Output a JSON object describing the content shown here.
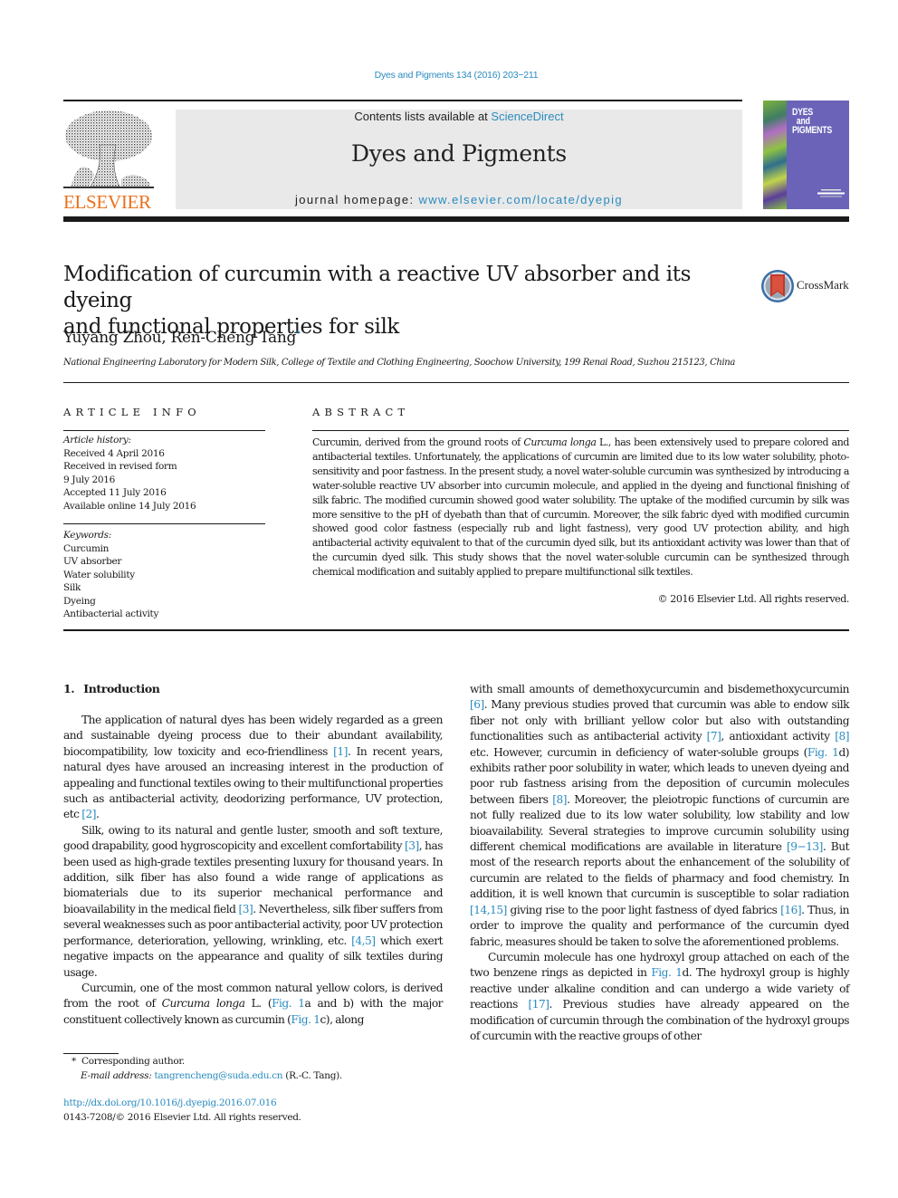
{
  "citation": "Dyes and Pigments 134 (2016) 203−211",
  "masthead": {
    "publisher_wordmark": "ELSEVIER",
    "contents_prefix": "Contents lists available at ",
    "contents_link": "ScienceDirect",
    "journal_name": "Dyes and Pigments",
    "homepage_prefix": "journal homepage: ",
    "homepage_link": "www.elsevier.com/locate/dyepig",
    "cover_title_lines": [
      "DYES",
      "and",
      "PIGMENTS"
    ],
    "colors": {
      "publisher_orange": "#e9711c",
      "link_blue": "#2a8bbf",
      "cover_purple": "#6a63b8",
      "masthead_gray": "#e9e9e9"
    }
  },
  "article": {
    "title_line1": "Modification of curcumin with a reactive UV absorber and its dyeing",
    "title_line2": "and functional properties for silk",
    "crossmark_label": "CrossMark",
    "authors": "Yuyang Zhou, Ren-Cheng Tang",
    "author_mark": "*",
    "affiliation": "National Engineering Laboratory for Modern Silk, College of Textile and Clothing Engineering, Soochow University, 199 Renai Road, Suzhou 215123, China"
  },
  "article_info": {
    "heading": "ARTICLE INFO",
    "history_label": "Article history:",
    "history": [
      "Received 4 April 2016",
      "Received in revised form",
      "9 July 2016",
      "Accepted 11 July 2016",
      "Available online 14 July 2016"
    ],
    "keywords_label": "Keywords:",
    "keywords": [
      "Curcumin",
      "UV absorber",
      "Water solubility",
      "Silk",
      "Dyeing",
      "Antibacterial activity"
    ]
  },
  "abstract": {
    "heading": "ABSTRACT",
    "text_before_italic": "Curcumin, derived from the ground roots of ",
    "italic": "Curcuma longa",
    "text_after_italic": " L., has been extensively used to prepare colored and antibacterial textiles. Unfortunately, the applications of curcumin are limited due to its low water solubility, photo-sensitivity and poor fastness. In the present study, a novel water-soluble curcumin was synthesized by introducing a water-soluble reactive UV absorber into curcumin molecule, and applied in the dyeing and functional finishing of silk fabric. The modified curcumin showed good water solubility. The uptake of the modified curcumin by silk was more sensitive to the pH of dyebath than that of curcumin. Moreover, the silk fabric dyed with modified curcumin showed good color fastness (especially rub and light fastness), very good UV protection ability, and high antibacterial activity equivalent to that of the curcumin dyed silk, but its antioxidant activity was lower than that of the curcumin dyed silk. This study shows that the novel water-soluble curcumin can be synthesized through chemical modification and suitably applied to prepare multifunctional silk textiles.",
    "copyright": "© 2016 Elsevier Ltd. All rights reserved."
  },
  "body": {
    "section_number": "1.",
    "section_title": "Introduction",
    "p1": {
      "a": "The application of natural dyes has been widely regarded as a green and sustainable dyeing process due to their abundant availability, biocompatibility, low toxicity and eco-friendliness ",
      "ref1": "[1]",
      "b": ". In recent years, natural dyes have aroused an increasing interest in the production of appealing and functional textiles owing to their multifunctional properties such as antibacterial activity, deodorizing performance, UV protection, etc ",
      "ref2": "[2]",
      "c": "."
    },
    "p2": {
      "a": "Silk, owing to its natural and gentle luster, smooth and soft texture, good drapability, good hygroscopicity and excellent comfortability ",
      "ref1": "[3]",
      "b": ", has been used as high-grade textiles presenting luxury for thousand years. In addition, silk fiber has also found a wide range of applications as biomaterials due to its superior mechanical performance and bioavailability in the medical field ",
      "ref2": "[3]",
      "c": ". Nevertheless, silk fiber suffers from several weaknesses such as poor antibacterial activity, poor UV protection performance, deterioration, yellowing, wrinkling, etc. ",
      "ref3": "[4,5]",
      "d": " which exert negative impacts on the appearance and quality of silk textiles during usage."
    },
    "p3": {
      "a": "Curcumin, one of the most common natural yellow colors, is derived from the root of ",
      "italic": "Curcuma longa",
      "b": " L. (",
      "fig1": "Fig. 1",
      "c": "a and b) with the major constituent collectively known as curcumin (",
      "fig2": "Fig. 1",
      "d": "c), along with small amounts of demethoxycurcumin and bisdemethoxycurcumin ",
      "ref1": "[6]",
      "e": ". Many previous studies proved that curcumin was able to endow silk fiber not only with brilliant yellow color but also with outstanding functionalities such as antibacterial activity ",
      "ref2": "[7]",
      "f": ", antioxidant activity ",
      "ref3": "[8]",
      "g": " etc. However, curcumin in deficiency of water-soluble groups (",
      "fig3": "Fig. 1",
      "h": "d) exhibits rather poor solubility in water, which leads to uneven dyeing and poor rub fastness arising from the deposition of curcumin molecules between fibers ",
      "ref4": "[8]",
      "i": ". Moreover, the pleiotropic functions of curcumin are not fully realized due to its low water solubility, low stability and low bioavailability. Several strategies to improve curcumin solubility using different chemical modifications are available in literature ",
      "ref5": "[9−13]",
      "j": ". But most of the research reports about the enhancement of the solubility of curcumin are related to the fields of pharmacy and food chemistry. In addition, it is well known that curcumin is susceptible to solar radiation ",
      "ref6": "[14,15]",
      "k": " giving rise to the poor light fastness of dyed fabrics ",
      "ref7": "[16]",
      "l": ". Thus, in order to improve the quality and performance of the curcumin dyed fabric, measures should be taken to solve the aforementioned problems."
    },
    "p4": {
      "a": "Curcumin molecule has one hydroxyl group attached on each of the two benzene rings as depicted in ",
      "fig1": "Fig. 1",
      "b": "d. The hydroxyl group is highly reactive under alkaline condition and can undergo a wide variety of reactions ",
      "ref1": "[17]",
      "c": ". Previous studies have already appeared on the modification of curcumin through the combination of the hydroxyl groups of curcumin with the reactive groups of other"
    }
  },
  "footnote": {
    "mark": "*",
    "corresponding": "Corresponding author.",
    "email_label": "E-mail address:",
    "email": "tangrencheng@suda.edu.cn",
    "email_suffix": " (R.-C. Tang)."
  },
  "footer": {
    "doi": "http://dx.doi.org/10.1016/j.dyepig.2016.07.016",
    "issn_copyright": "0143-7208/© 2016 Elsevier Ltd. All rights reserved."
  }
}
